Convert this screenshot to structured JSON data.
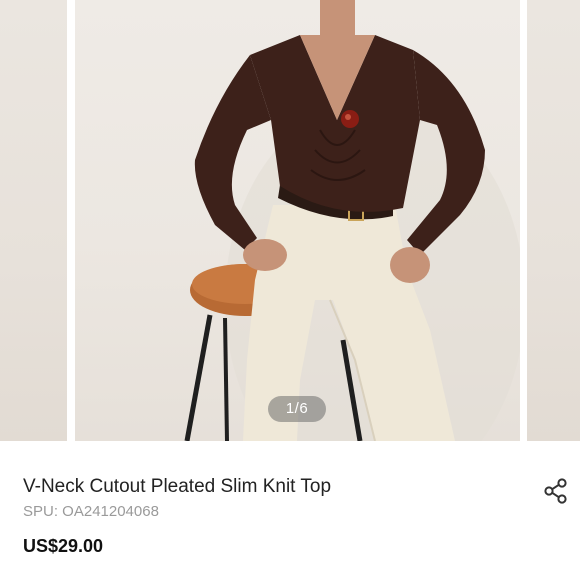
{
  "gallery": {
    "counter": "1/6"
  },
  "product": {
    "title": "V-Neck Cutout Pleated Slim Knit Top",
    "spu": "SPU: OA241204068",
    "price": "US$29.00"
  },
  "icons": {
    "share": "share-icon"
  },
  "colors": {
    "garment": "#3d211a",
    "trousers": "#efe8d8",
    "stool_seat": "#b86a34",
    "price_text": "#111111",
    "muted_text": "#9a9a9a"
  }
}
